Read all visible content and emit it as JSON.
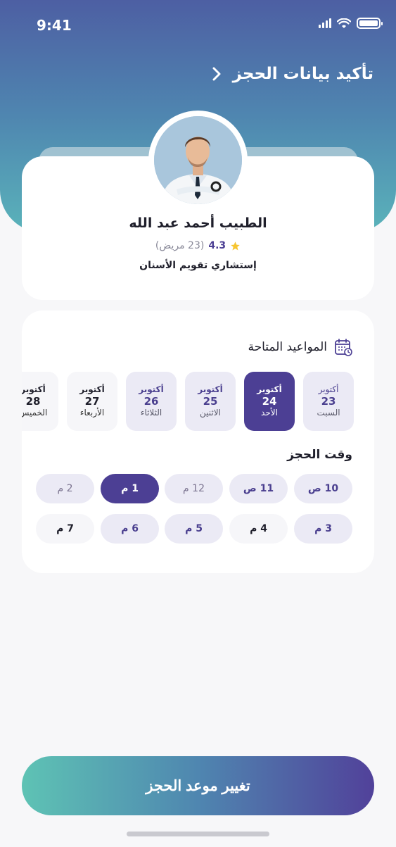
{
  "status_bar": {
    "time": "9:41"
  },
  "header": {
    "title": "تأكيد بيانات الحجز"
  },
  "doctor": {
    "name": "الطبيب أحمد عبد الله",
    "rating": "4.3",
    "patients": "(23 مريض)",
    "specialty": "إستشاري تقويم الأسنان"
  },
  "schedule": {
    "title": "المواعيد المتاحة",
    "dates": [
      {
        "month": "أكتوبر",
        "day": "23",
        "weekday": "السبت",
        "state": "available"
      },
      {
        "month": "أكتوبر",
        "day": "24",
        "weekday": "الأحد",
        "state": "selected"
      },
      {
        "month": "أكتوبر",
        "day": "25",
        "weekday": "الاثنين",
        "state": "available"
      },
      {
        "month": "أكتوبر",
        "day": "26",
        "weekday": "الثلاثاء",
        "state": "available"
      },
      {
        "month": "أكتوبر",
        "day": "27",
        "weekday": "الأربعاء",
        "state": "unavailable"
      },
      {
        "month": "أكتوبر",
        "day": "28",
        "weekday": "الخميس",
        "state": "unavailable"
      }
    ]
  },
  "booking_time": {
    "title": "وقت الحجز",
    "slots": [
      {
        "label": "10 ص",
        "state": "available"
      },
      {
        "label": "11 ص",
        "state": "available"
      },
      {
        "label": "12 م",
        "state": "dim"
      },
      {
        "label": "1 م",
        "state": "selected"
      },
      {
        "label": "2 م",
        "state": "dim"
      },
      {
        "label": "3 م",
        "state": "available"
      },
      {
        "label": "4 م",
        "state": "unavailable"
      },
      {
        "label": "5 م",
        "state": "available"
      },
      {
        "label": "6 م",
        "state": "available"
      },
      {
        "label": "7 م",
        "state": "unavailable"
      }
    ]
  },
  "cta": {
    "label": "تغيير موعد الحجز"
  },
  "colors": {
    "primary": "#4c3f94",
    "teal": "#5ec3b4",
    "header_top": "#4d5fa3",
    "chip": "#ebeaf5",
    "star": "#f6c531"
  }
}
